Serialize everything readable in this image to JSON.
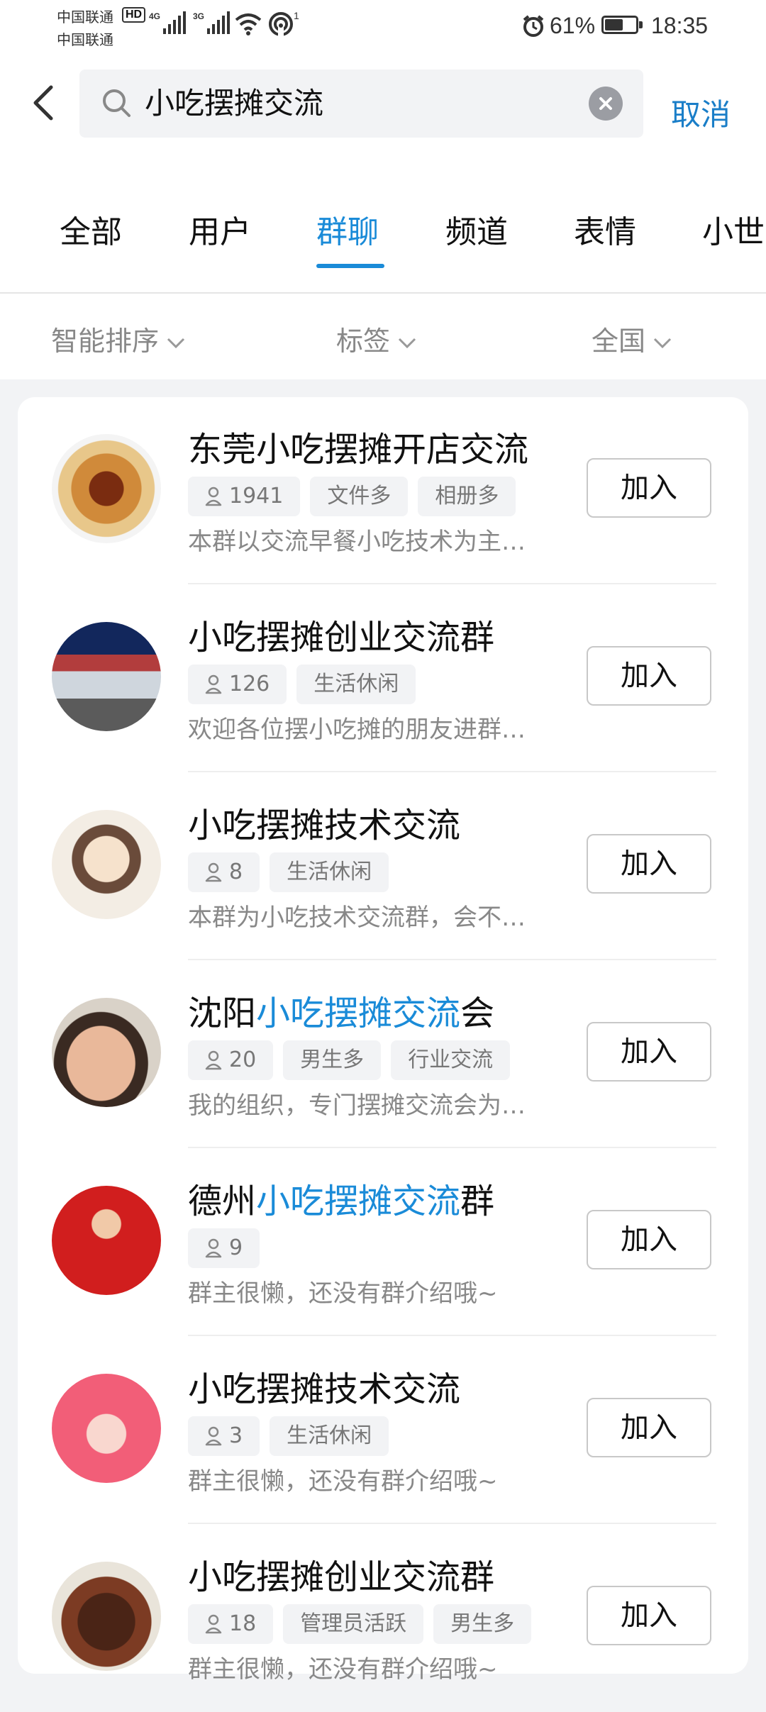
{
  "status_bar": {
    "carrier_1": "中国联通",
    "carrier_2": "中国联通",
    "hd": "HD",
    "net_1": "4G",
    "net_2": "3G",
    "hotspot_count": "1",
    "battery": "61%",
    "battery_level": 0.61,
    "time": "18:35"
  },
  "search": {
    "query": "小吃摆摊交流",
    "cancel_label": "取消"
  },
  "tabs": [
    "全部",
    "用户",
    "群聊",
    "频道",
    "表情",
    "小世"
  ],
  "active_tab": "群聊",
  "filters": [
    "智能排序",
    "标签",
    "全国"
  ],
  "join_label": "加入",
  "groups": [
    {
      "title_pre": "东莞小吃摆摊开店交流",
      "title_hl": "",
      "title_post": "",
      "members": "1941",
      "tags": [
        "文件多",
        "相册多"
      ],
      "desc": "本群以交流早餐小吃技术为主…",
      "avatar_icon": "food-noodles-avatar"
    },
    {
      "title_pre": "小吃摆摊创业交流群",
      "title_hl": "",
      "title_post": "",
      "members": "126",
      "tags": [
        "生活休闲"
      ],
      "desc": "欢迎各位摆小吃摊的朋友进群…",
      "avatar_icon": "street-stall-avatar"
    },
    {
      "title_pre": "小吃摆摊技术交流",
      "title_hl": "",
      "title_post": "",
      "members": "8",
      "tags": [
        "生活休闲"
      ],
      "desc": "本群为小吃技术交流群，会不…",
      "avatar_icon": "cartoon-girl-avatar"
    },
    {
      "title_pre": "沈阳",
      "title_hl": "小吃摆摊交流",
      "title_post": "会",
      "members": "20",
      "tags": [
        "男生多",
        "行业交流"
      ],
      "desc": "我的组织，专门摆摊交流会为…",
      "avatar_icon": "selfie-face-avatar"
    },
    {
      "title_pre": "德州",
      "title_hl": "小吃摆摊交流",
      "title_post": "群",
      "members": "9",
      "tags": [],
      "desc": "群主很懒，还没有群介绍哦~",
      "avatar_icon": "red-festive-avatar"
    },
    {
      "title_pre": "小吃摆摊技术交流",
      "title_hl": "",
      "title_post": "",
      "members": "3",
      "tags": [
        "生活休闲"
      ],
      "desc": "群主很懒，还没有群介绍哦~",
      "avatar_icon": "hand-gesture-avatar"
    },
    {
      "title_pre": "小吃摆摊创业交流群",
      "title_hl": "",
      "title_post": "",
      "members": "18",
      "tags": [
        "管理员活跃",
        "男生多"
      ],
      "desc": "群主很懒，还没有群介绍哦~",
      "avatar_icon": "stir-fry-dish-avatar"
    }
  ],
  "colors": {
    "accent": "#1a8bd8",
    "cancel": "#1a7ec8"
  }
}
